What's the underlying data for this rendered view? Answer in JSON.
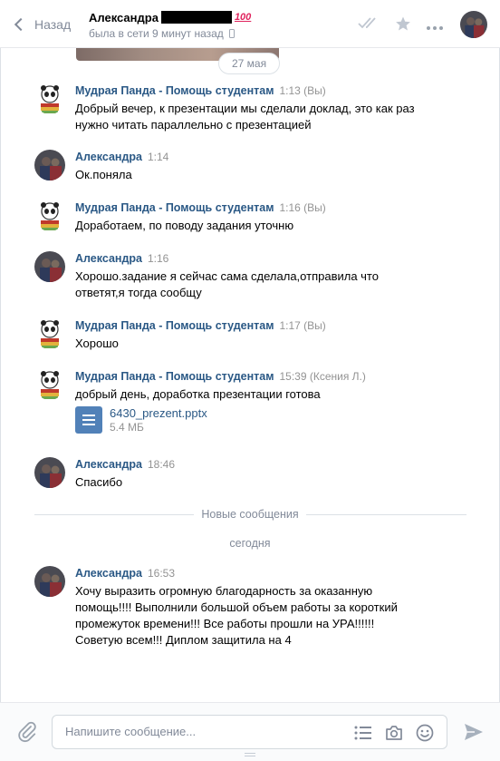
{
  "header": {
    "back_label": "Назад",
    "peer_name": "Александра",
    "peer_emoji": "100",
    "peer_status": "была в сети 9 минут назад",
    "icons": [
      "double-check-icon",
      "star-icon",
      "more-icon"
    ]
  },
  "chat": {
    "date_pill": "27 мая",
    "new_messages_label": "Новые сообщения",
    "today_label": "сегодня",
    "messages": [
      {
        "author": "Мудрая Панда - Помощь студентам",
        "time": "1:13 (Вы)",
        "text": "Добрый вечер, к презентации мы сделали доклад, это как раз\nнужно читать параллельно с презентацией"
      },
      {
        "author": "Александра",
        "time": "1:14",
        "text": "Ок.поняла"
      },
      {
        "author": "Мудрая Панда - Помощь студентам",
        "time": "1:16 (Вы)",
        "text": "Доработаем, по поводу задания уточню"
      },
      {
        "author": "Александра",
        "time": "1:16",
        "text": "Хорошо.задание я сейчас сама сделала,отправила что\nответят,я тогда сообщу"
      },
      {
        "author": "Мудрая Панда - Помощь студентам",
        "time": "1:17 (Вы)",
        "text": "Хорошо"
      },
      {
        "author": "Мудрая Панда - Помощь студентам",
        "time": "15:39 (Ксения Л.)",
        "text": "добрый день, доработка презентации готова",
        "attachment": {
          "name": "6430_prezent.pptx",
          "size": "5.4 МБ"
        }
      },
      {
        "author": "Александра",
        "time": "18:46",
        "text": "Спасибо"
      },
      {
        "author": "Александра",
        "time": "16:53",
        "text": "Хочу выразить огромную благодарность за оказанную\nпомощь!!!! Выполнили большой объем работы за короткий\nпромежуток времени!!! Все работы прошли на УРА!!!!!!\nСоветую всем!!! Диплом защитила на 4"
      }
    ]
  },
  "composer": {
    "placeholder": "Напишите сообщение..."
  },
  "colors": {
    "link": "#2a5885",
    "muted": "#828a99",
    "accent": "#5181b8"
  }
}
